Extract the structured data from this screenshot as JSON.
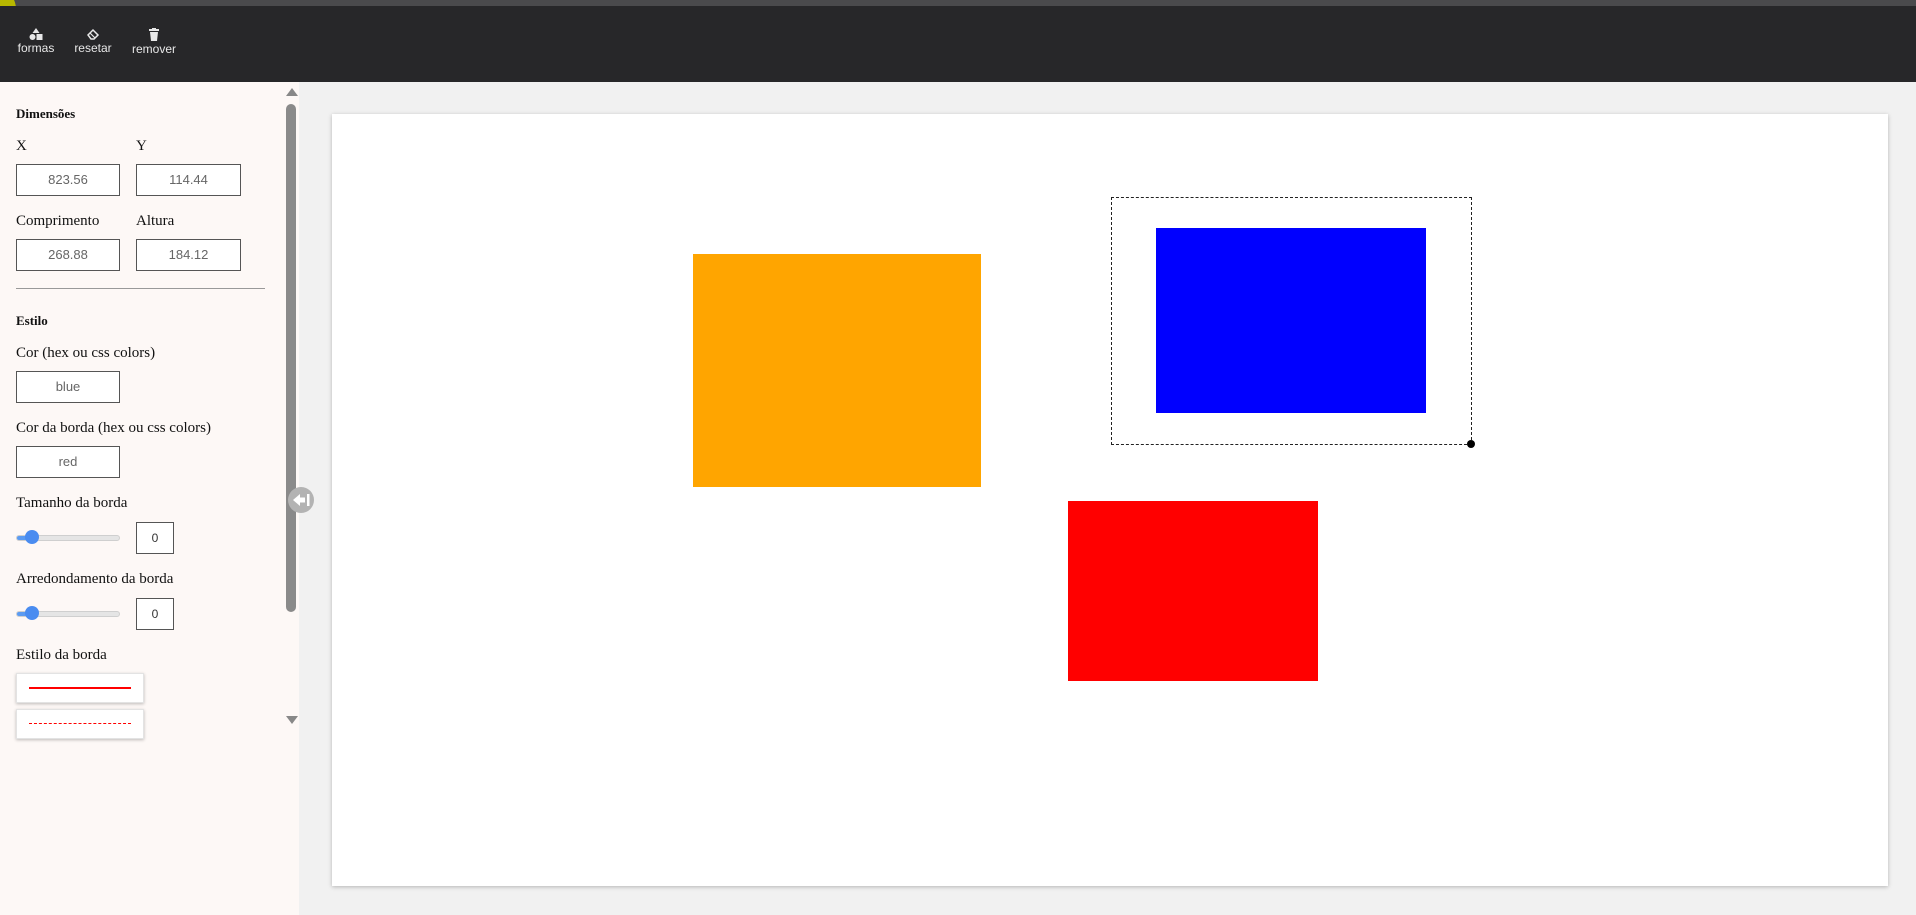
{
  "toolbar": {
    "formas_label": "formas",
    "resetar_label": "resetar",
    "remover_label": "remover"
  },
  "sidebar": {
    "dimensions_title": "Dimensões",
    "x_label": "X",
    "x_value": "823.56",
    "y_label": "Y",
    "y_value": "114.44",
    "width_label": "Comprimento",
    "width_value": "268.88",
    "height_label": "Altura",
    "height_value": "184.12",
    "style_title": "Estilo",
    "color_label": "Cor (hex ou css colors)",
    "color_value": "blue",
    "border_color_label": "Cor da borda (hex ou css colors)",
    "border_color_value": "red",
    "border_size_label": "Tamanho da borda",
    "border_size_value": "0",
    "border_radius_label": "Arredondamento da borda",
    "border_radius_value": "0",
    "border_style_label": "Estilo da borda",
    "border_style_options": [
      "solid",
      "dashed"
    ]
  },
  "canvas": {
    "shapes": [
      {
        "name": "shape-orange-rect",
        "color": "#ffa500"
      },
      {
        "name": "shape-blue-rect",
        "color": "#0000ff",
        "selected": true
      },
      {
        "name": "shape-red-rect",
        "color": "#ff0000"
      }
    ]
  },
  "colors": {
    "toolbar_bg": "#272729",
    "sidebar_bg": "#fdf8f6",
    "accent": "#4a8cf0",
    "border_style_preview": "#ff0000"
  },
  "icons": {
    "formas": "shapes-icon",
    "resetar": "eraser-icon",
    "remover": "trash-icon",
    "collapse": "collapse-sidebar-icon"
  }
}
